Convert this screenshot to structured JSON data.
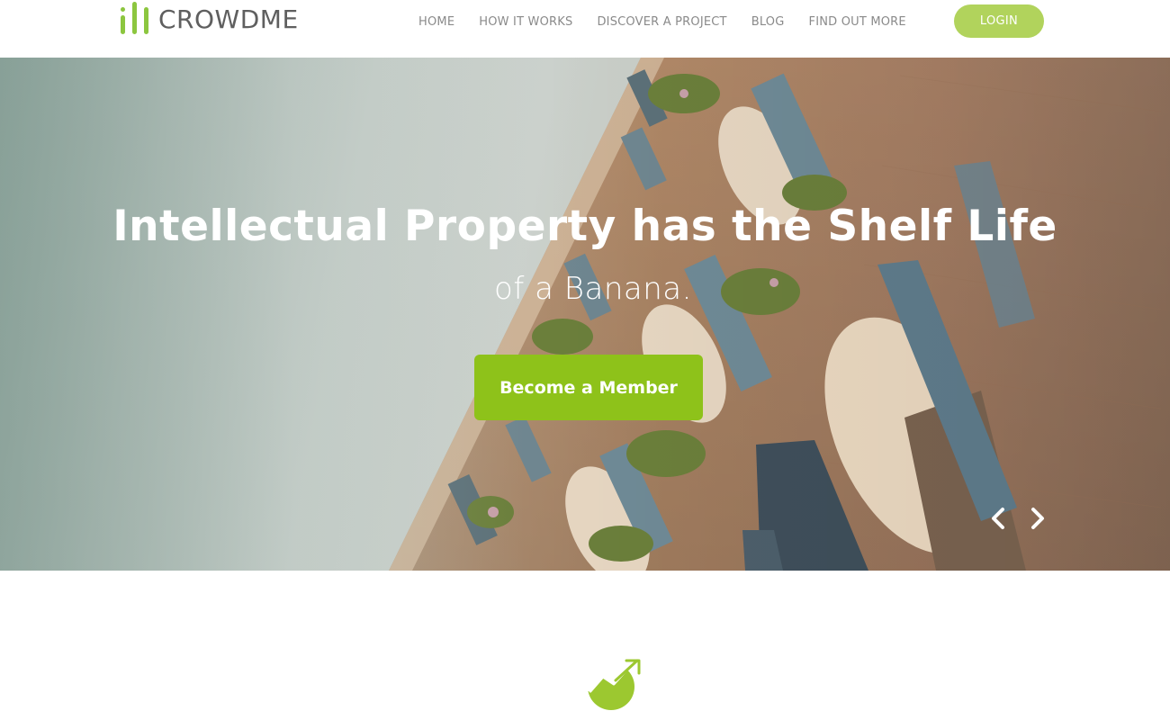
{
  "brand": {
    "name": "CROWDME",
    "accent_color": "#8cc63f"
  },
  "nav": {
    "items": [
      "HOME",
      "HOW IT WORKS",
      "DISCOVER A PROJECT",
      "BLOG",
      "FIND OUT MORE"
    ],
    "login_label": "LOGIN"
  },
  "hero": {
    "title": "Intellectual Property has the Shelf Life",
    "subtitle": "of a Banana.",
    "cta_label": "Become a Member",
    "cta_color": "#8ec21a",
    "image": "building-facade-with-shutters-and-flower-boxes"
  },
  "slider": {
    "prev_icon": "chevron-left-icon",
    "next_icon": "chevron-right-icon"
  },
  "feature": {
    "icon": "growth-chart-icon"
  }
}
